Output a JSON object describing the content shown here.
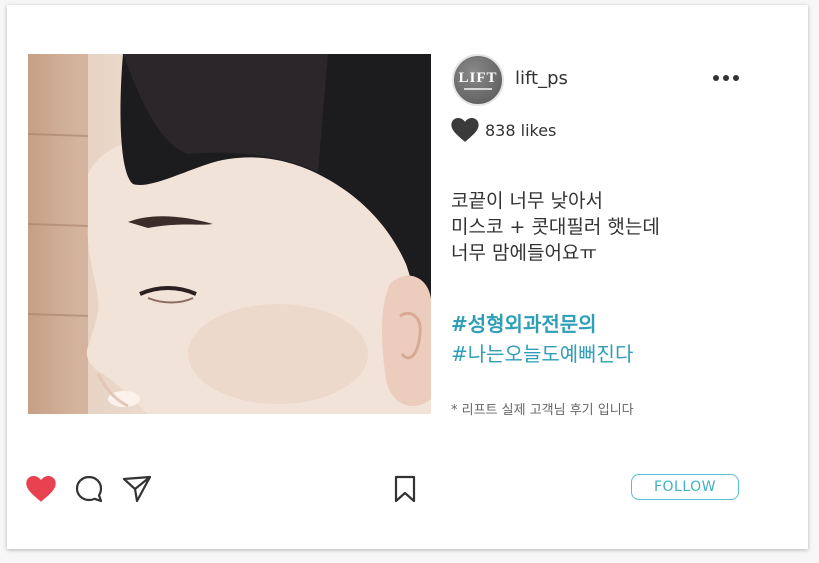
{
  "post": {
    "username": "lift_ps",
    "avatar_text": "LIFT",
    "likes": "838 likes",
    "caption_lines": [
      "코끝이 너무 낮아서",
      "미스코 + 콧대필러 햇는데",
      "너무 맘에들어요ㅠ"
    ],
    "hashtags": [
      "#성형외과전문의",
      "#나는오늘도예뻐진다"
    ],
    "note": "* 리프트 실제 고객님 후기 입니다",
    "follow_label": "FOLLOW"
  },
  "icons": {
    "more": "more-dots-icon",
    "likes": "heart-icon",
    "like_action": "heart-filled-icon",
    "comment": "comment-icon",
    "share": "send-icon",
    "save": "bookmark-icon"
  },
  "colors": {
    "accent": "#2f9eb7",
    "like_red": "#e8414f",
    "text": "#333333"
  }
}
